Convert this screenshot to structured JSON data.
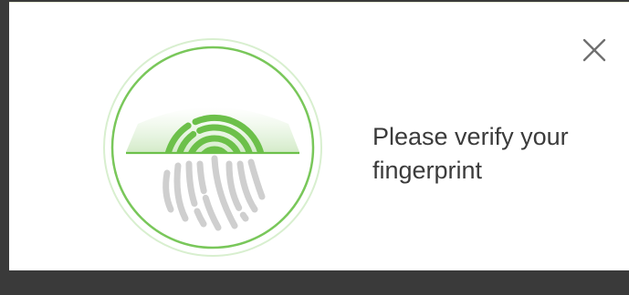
{
  "dialog": {
    "message": "Please verify your fingerprint",
    "close_icon": "close-icon"
  },
  "sensor": {
    "icon": "fingerprint-icon",
    "progress": 0.5
  },
  "colors": {
    "accent": "#6cc04a",
    "ring_inner": "#79c75a",
    "ring_outer": "#d8efcf",
    "fingerprint_pending": "#cfcfcf",
    "text": "#3b3b3b",
    "close": "#707070"
  }
}
